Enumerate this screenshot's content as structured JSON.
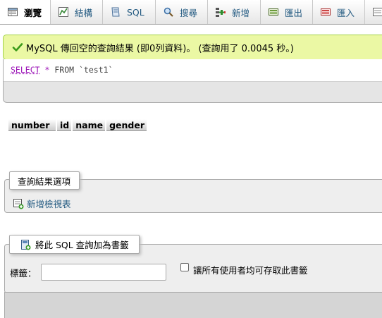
{
  "tabs": [
    {
      "label": "瀏覽",
      "icon": "browse-icon",
      "active": true
    },
    {
      "label": "結構",
      "icon": "structure-icon",
      "active": false
    },
    {
      "label": "SQL",
      "icon": "sql-icon",
      "active": false
    },
    {
      "label": "搜尋",
      "icon": "search-icon",
      "active": false
    },
    {
      "label": "新增",
      "icon": "insert-icon",
      "active": false
    },
    {
      "label": "匯出",
      "icon": "export-icon",
      "active": false
    },
    {
      "label": "匯入",
      "icon": "import-icon",
      "active": false
    }
  ],
  "message": {
    "icon": "check-icon",
    "text": "MySQL 傳回空的查詢結果 (即0列資料)。 (查詢用了 0.0045 秒。)"
  },
  "sql": {
    "select": "SELECT",
    "star": "*",
    "from": "FROM",
    "table": "`test1`"
  },
  "columns": [
    "number",
    "id",
    "name",
    "gender"
  ],
  "query_options": {
    "legend": "查詢結果選項",
    "create_view": "新增檢視表"
  },
  "bookmark": {
    "legend": "將此 SQL 查詢加為書籤",
    "label": "標籤：",
    "label_value": "",
    "share_label": "讓所有使用者均可存取此書籤"
  },
  "colors": {
    "success_bg": "#ebf8a4",
    "success_border": "#a2d246",
    "link": "#235a81",
    "keyword": "#9a0fb6"
  }
}
